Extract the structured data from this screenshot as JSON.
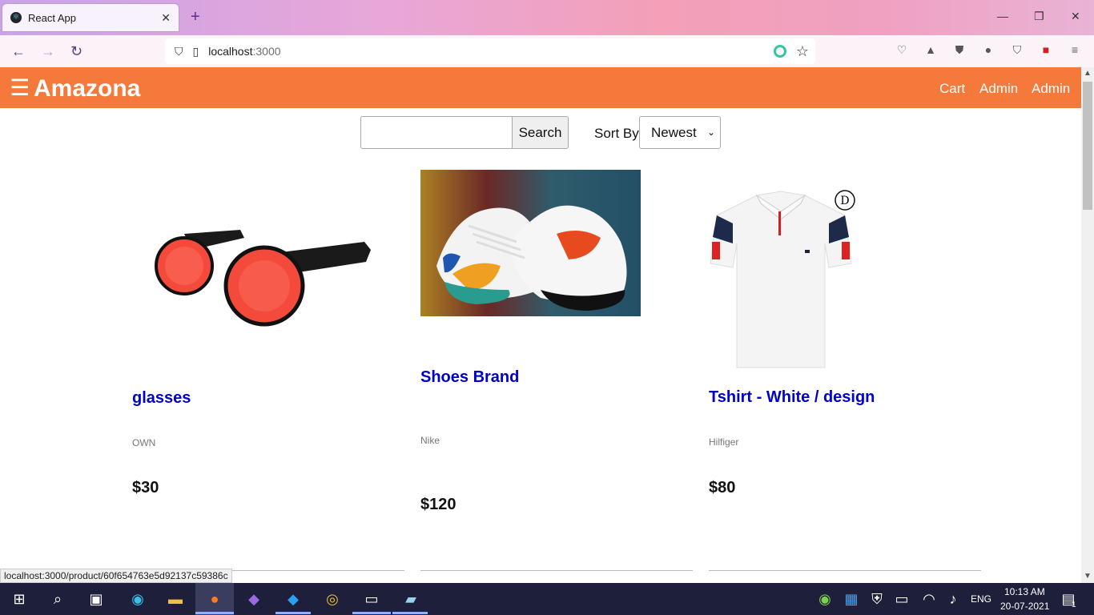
{
  "browser": {
    "tab_title": "React App",
    "tab_close": "✕",
    "new_tab": "+",
    "url_host": "localhost",
    "url_port": ":3000",
    "status_url": "localhost:3000/product/60f654763e5d92137c59386c"
  },
  "header": {
    "menu_icon": "☰",
    "brand": "Amazona",
    "links": [
      "Cart",
      "Admin",
      "Admin"
    ]
  },
  "search": {
    "input_value": "",
    "button_label": "Search",
    "sort_label": "Sort By",
    "sort_value": "Newest"
  },
  "products": [
    {
      "name": "glasses",
      "brand": "OWN",
      "price": "$30",
      "image": "red-round-sunglasses"
    },
    {
      "name": "Shoes Brand",
      "brand": "Nike",
      "price": "$120",
      "image": "sneakers-photo"
    },
    {
      "name": "Tshirt - White / design",
      "brand": "Hilfiger",
      "price": "$80",
      "image": "white-polo-shirt"
    }
  ],
  "taskbar": {
    "time": "10:13 AM",
    "date": "20-07-2021",
    "language": "ENG",
    "notifications": "1"
  },
  "colors": {
    "header": "#f5793b",
    "link": "#0000cc"
  }
}
